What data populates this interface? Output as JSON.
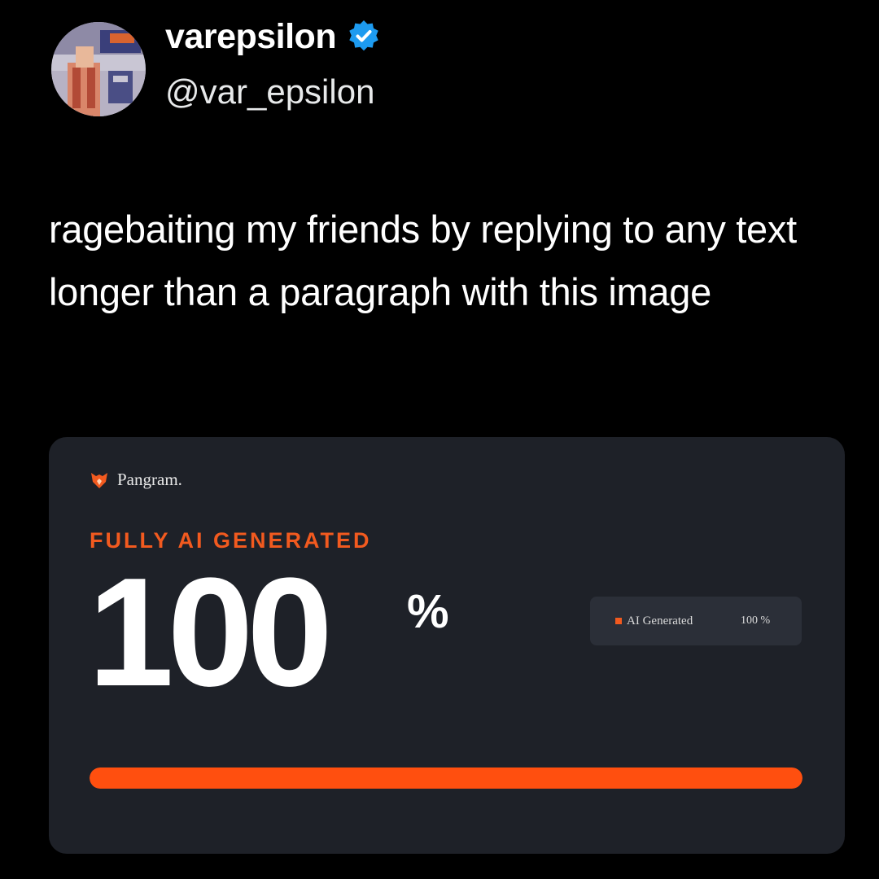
{
  "tweet": {
    "author": {
      "display_name": "varepsilon",
      "handle": "@var_epsilon",
      "verified": true,
      "verified_icon": "verified-badge-icon",
      "avatar": "avatar-artwork-image"
    },
    "text": "ragebaiting my friends by replying to any text longer than a paragraph with this image"
  },
  "card": {
    "brand": {
      "name": "Pangram.",
      "icon": "fox-shield-icon"
    },
    "verdict_label": "FULLY AI GENERATED",
    "score_value": "100",
    "score_unit": "%",
    "legend": {
      "label": "AI Generated",
      "value": "100 %"
    },
    "progress_fraction": 1.0
  },
  "colors": {
    "background": "#000000",
    "card_background": "#1e2128",
    "accent_orange": "#f25a1f",
    "progress_fill": "#ff4f0f",
    "verified_blue": "#1d9bf0",
    "text_primary": "#ffffff"
  }
}
